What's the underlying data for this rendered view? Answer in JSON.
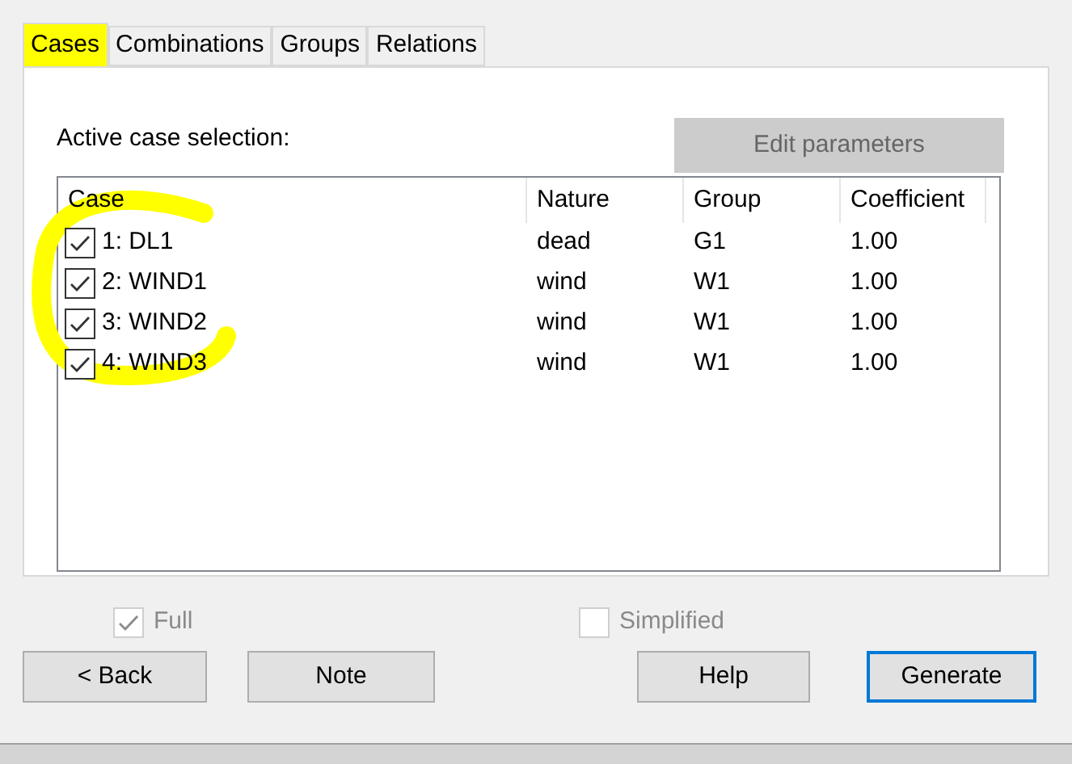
{
  "tabs": [
    {
      "label": "Cases",
      "selected": true,
      "highlighted": true
    },
    {
      "label": "Combinations",
      "selected": false,
      "highlighted": false
    },
    {
      "label": "Groups",
      "selected": false,
      "highlighted": false
    },
    {
      "label": "Relations",
      "selected": false,
      "highlighted": false
    }
  ],
  "panel": {
    "label": "Active case selection:",
    "edit_button": {
      "label": "Edit parameters",
      "disabled": true
    },
    "list": {
      "columns": [
        "Case",
        "Nature",
        "Group",
        "Coefficient"
      ],
      "annotation_circle": true,
      "rows": [
        {
          "case": "1: DL1",
          "checked": true,
          "nature": "dead",
          "group": "G1",
          "coefficient": "1.00"
        },
        {
          "case": "2: WIND1",
          "checked": true,
          "nature": "wind",
          "group": "W1",
          "coefficient": "1.00"
        },
        {
          "case": "3: WIND2",
          "checked": true,
          "nature": "wind",
          "group": "W1",
          "coefficient": "1.00"
        },
        {
          "case": "4: WIND3",
          "checked": true,
          "nature": "wind",
          "group": "W1",
          "coefficient": "1.00"
        }
      ]
    }
  },
  "options": [
    {
      "label": "Full",
      "checked": true,
      "disabled": true
    },
    {
      "label": "Simplified",
      "checked": false,
      "disabled": true
    }
  ],
  "buttons": [
    {
      "label": "< Back",
      "default": false
    },
    {
      "label": "Note",
      "default": false
    },
    {
      "label": "Help",
      "default": false
    },
    {
      "label": "Generate",
      "default": true
    }
  ]
}
